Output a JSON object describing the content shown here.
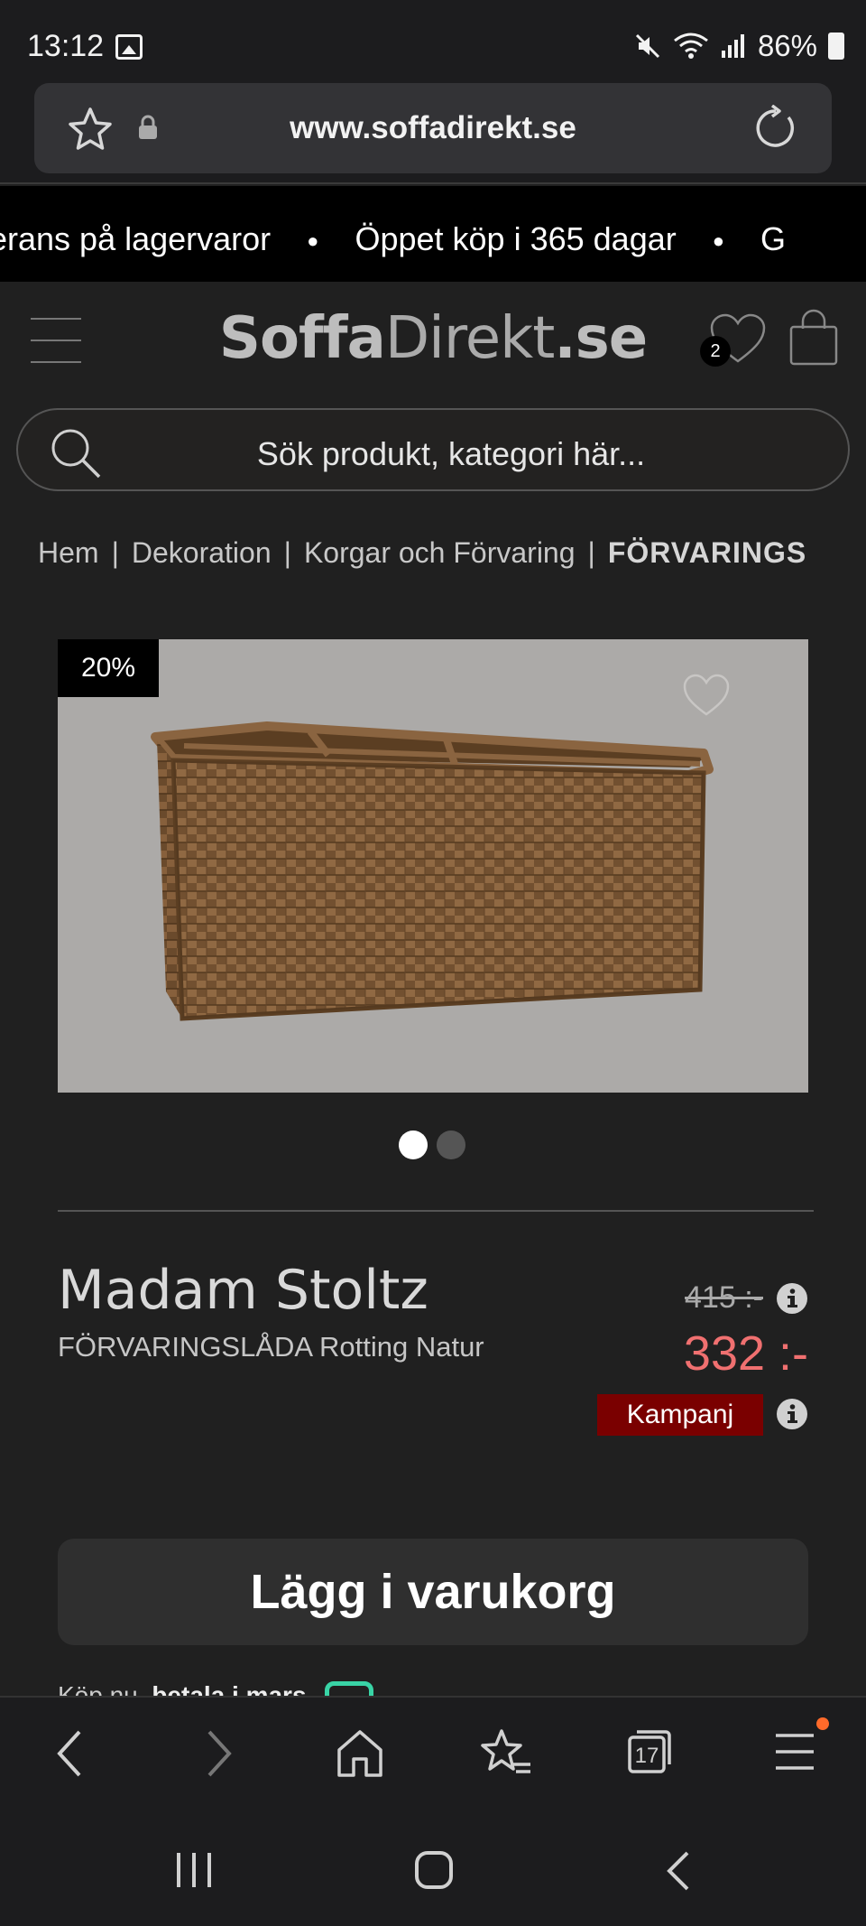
{
  "status_bar": {
    "time": "13:12",
    "battery": "86%"
  },
  "browser": {
    "url": "www.soffadirekt.se"
  },
  "marquee": {
    "items": [
      "erans på lagervaror",
      "Öppet köp i 365 dagar",
      "G"
    ]
  },
  "header": {
    "logo_part1": "Soffa",
    "logo_part2": "Direkt",
    "logo_part3": ".se",
    "wishlist_count": "2"
  },
  "search": {
    "placeholder": "Sök produkt, kategori här..."
  },
  "breadcrumb": {
    "items": [
      "Hem",
      "Dekoration",
      "Korgar och Förvaring"
    ],
    "current": "FÖRVARINGS"
  },
  "product": {
    "discount": "20%",
    "brand": "Madam Stoltz",
    "name": "FÖRVARINGSLÅDA Rotting Natur",
    "old_price": "415 :-",
    "price": "332 :-",
    "campaign_label": "Kampanj",
    "add_to_cart": "Lägg i varukorg",
    "pay_text_1": "Köp nu,",
    "pay_text_2": "betala i mars",
    "gallery_count": 2,
    "gallery_active": 1
  },
  "browser_nav": {
    "tabs_count": "17"
  },
  "colors": {
    "accent_price": "#f07070",
    "campaign_bg": "#7a0000",
    "background": "#202020"
  }
}
